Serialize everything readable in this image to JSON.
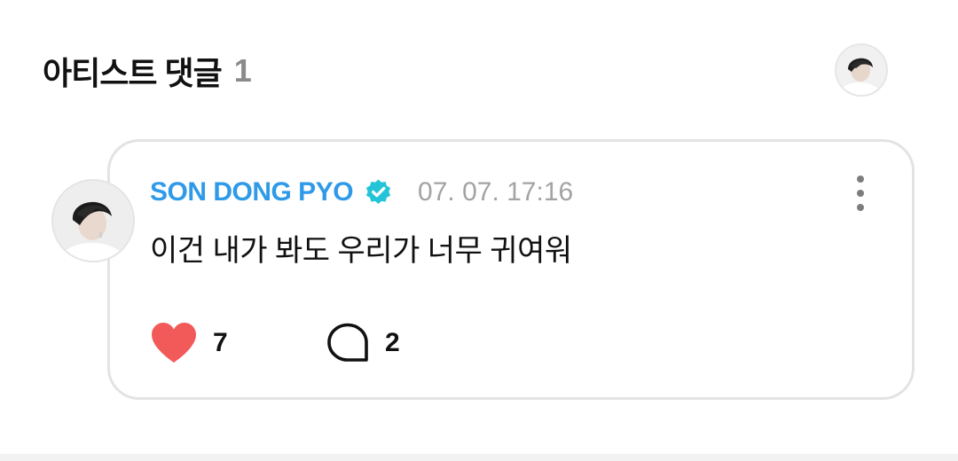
{
  "section": {
    "title": "아티스트 댓글",
    "count": "1"
  },
  "comment": {
    "author": "SON DONG PYO",
    "verified_icon": "verified-badge-icon",
    "timestamp": "07. 07. 17:16",
    "text": "이건 내가 봐도 우리가 너무 귀여워",
    "likes": "7",
    "replies": "2"
  },
  "icons": {
    "like": "heart-icon",
    "reply": "speech-bubble-icon",
    "more": "more-vertical-icon",
    "avatar": "artist-avatar"
  },
  "colors": {
    "author_name": "#2f9ae8",
    "verified_badge": "#24c4d8",
    "heart": "#f25a5a",
    "timestamp": "#a3a3a3",
    "count_muted": "#8a8a8a",
    "card_border": "#e3e3e3"
  }
}
